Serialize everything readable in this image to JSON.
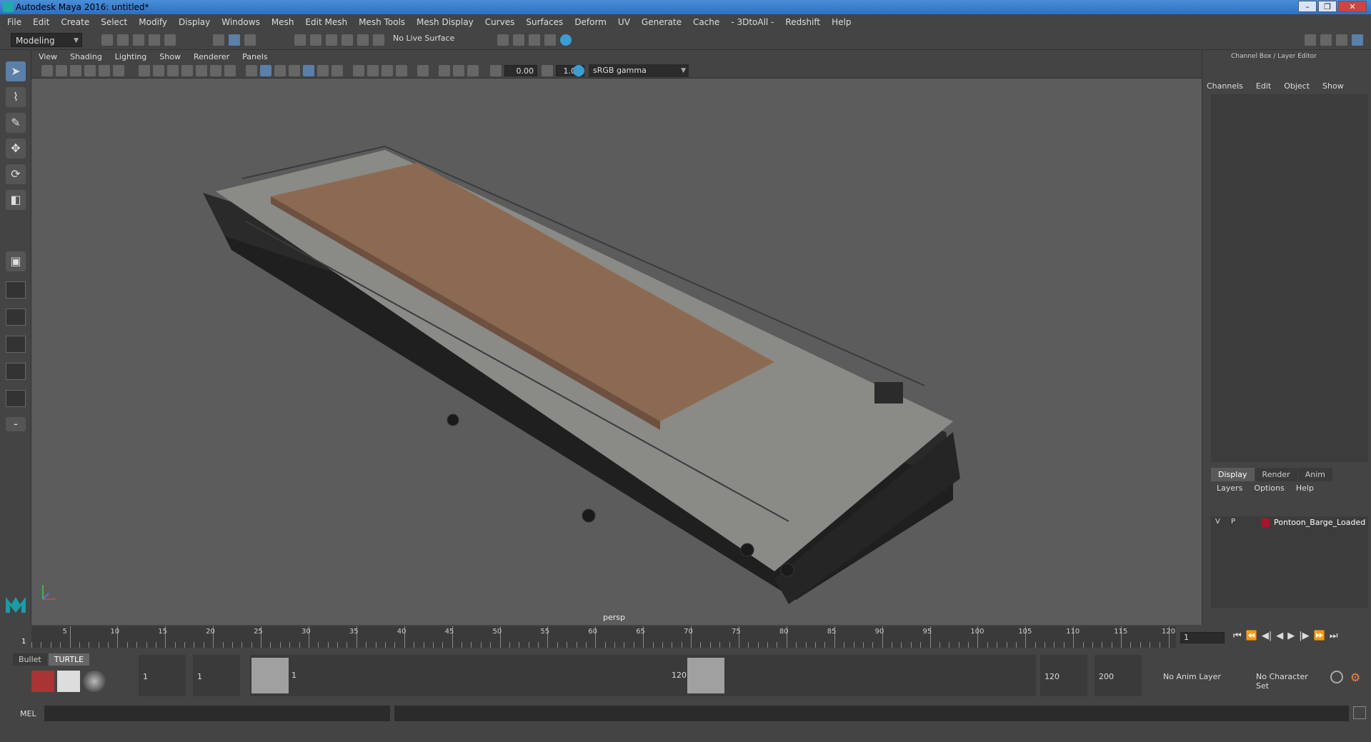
{
  "window": {
    "title": "Autodesk Maya 2016: untitled*"
  },
  "menubar": [
    "File",
    "Edit",
    "Create",
    "Select",
    "Modify",
    "Display",
    "Windows",
    "Mesh",
    "Edit Mesh",
    "Mesh Tools",
    "Mesh Display",
    "Curves",
    "Surfaces",
    "Deform",
    "UV",
    "Generate",
    "Cache",
    "- 3DtoAll -",
    "Redshift",
    "Help"
  ],
  "statusline": {
    "mode": "Modeling",
    "live_surface": "No Live Surface"
  },
  "viewport": {
    "menu": [
      "View",
      "Shading",
      "Lighting",
      "Show",
      "Renderer",
      "Panels"
    ],
    "exposure": "0.00",
    "gamma": "1.00",
    "color_space": "sRGB gamma",
    "camera": "persp"
  },
  "channelbox": {
    "title": "Channel Box / Layer Editor",
    "tabs": [
      "Channels",
      "Edit",
      "Object",
      "Show"
    ]
  },
  "layereditor": {
    "tabs": [
      "Display",
      "Render",
      "Anim"
    ],
    "menu": [
      "Layers",
      "Options",
      "Help"
    ],
    "layer": {
      "v": "V",
      "p": "P",
      "name": "Pontoon_Barge_Loaded",
      "color": "#b0102a"
    }
  },
  "timeslider": {
    "ticks": [
      "5",
      "10",
      "15",
      "20",
      "25",
      "30",
      "35",
      "40",
      "45",
      "50",
      "55",
      "60",
      "65",
      "70",
      "75",
      "80",
      "85",
      "90",
      "95",
      "100",
      "105",
      "110",
      "115",
      "120"
    ],
    "start_label": "1",
    "current_frame": "1"
  },
  "rangeslider": {
    "shelf_tabs": [
      "Bullet",
      "TURTLE"
    ],
    "start": "1",
    "playback_start": "1",
    "handle_start": "1",
    "handle_end": "120",
    "playback_end": "120",
    "end": "200",
    "anim_layer": "No Anim Layer",
    "character_set": "No Character Set"
  },
  "commandline": {
    "label": "MEL"
  }
}
